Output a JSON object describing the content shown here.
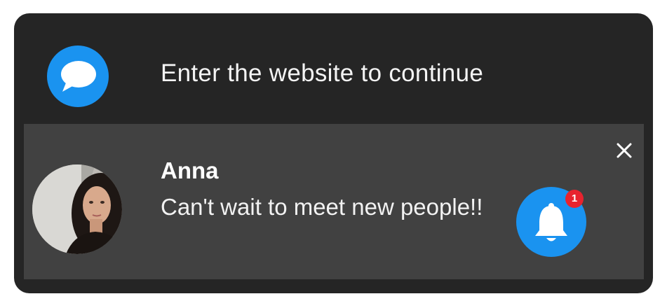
{
  "banner": {
    "text": "Enter the website to continue",
    "icon": "chat-bubble-icon",
    "accent_color": "#1a93f0"
  },
  "notification": {
    "sender": "Anna",
    "message": "Can't wait to meet new people!!",
    "close_icon": "close-icon",
    "bell_icon": "bell-icon",
    "badge_count": "1",
    "badge_color": "#e8232e"
  }
}
